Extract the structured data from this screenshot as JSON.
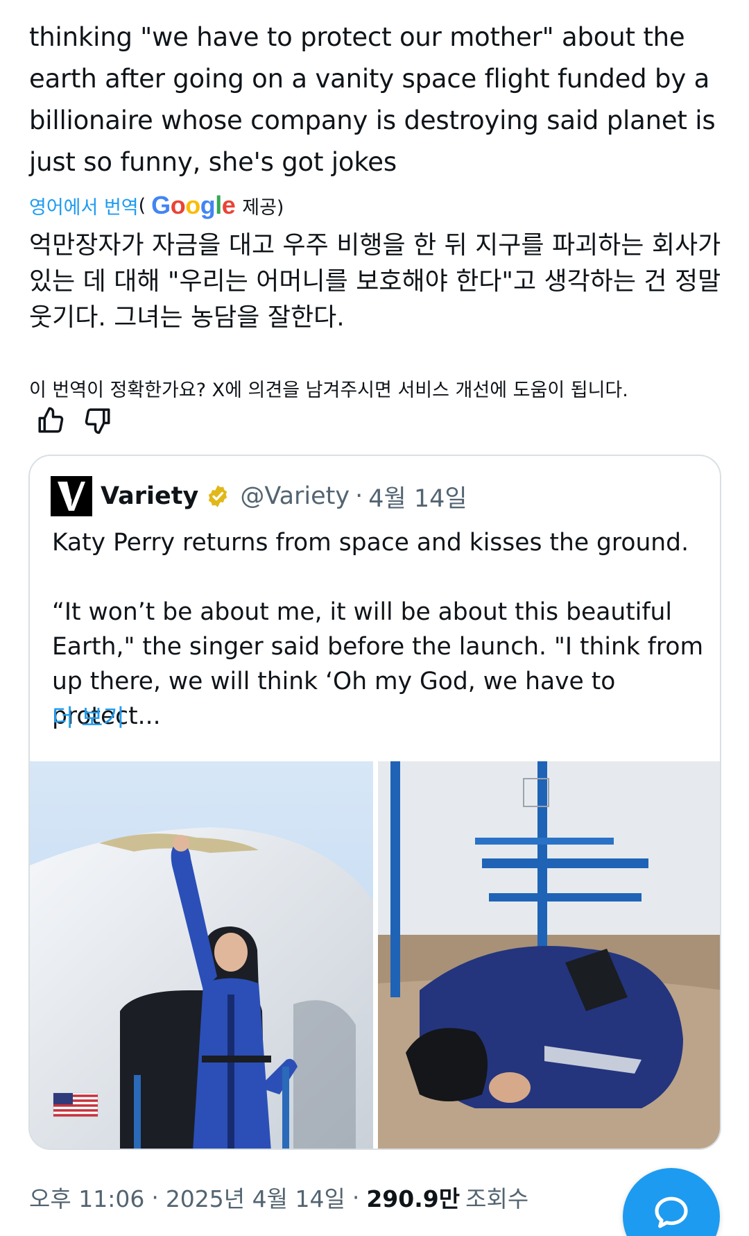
{
  "post": {
    "text": "thinking \"we have to protect our mother\" about the earth after going on a vanity space flight funded by a billionaire whose company is destroying said planet is just so funny, she's got jokes",
    "translate_label": "영어에서 번역",
    "paren_open": "(",
    "google_letters": [
      "G",
      "o",
      "o",
      "g",
      "l",
      "e"
    ],
    "provided_label": "제공)",
    "translated_text": "억만장자가 자금을 대고 우주 비행을 한 뒤 지구를 파괴하는 회사가 있는 데 대해 \"우리는 어머니를 보호해야 한다\"고 생각하는 건 정말 웃기다. 그녀는 농담을 잘한다.",
    "feedback_question": "이 번역이 정확한가요? X에 의견을 남겨주시면 서비스 개선에 도움이 됩니다.",
    "thumbs_up_icon": "thumbs-up-icon",
    "thumbs_down_icon": "thumbs-down-icon"
  },
  "quoted": {
    "name": "Variety",
    "handle": "@Variety",
    "dot": "·",
    "date": "4월 14일",
    "paragraph1": "Katy Perry returns from space and kisses the ground.",
    "paragraph2": "“It won’t be about me, it will be about this beautiful Earth,\" the singer said before the launch. \"I think from up there, we will think ‘Oh my God, we have to protect...",
    "show_more": "더 보기",
    "verified_color": "#e2b719",
    "avatar_icon": "variety-v-logo"
  },
  "footer": {
    "time": "오후 11:06",
    "sep1": "·",
    "date": "2025년 4월 14일",
    "sep2": "·",
    "views": "290.9만",
    "views_label": "조회수"
  },
  "fab_icon": "compose-reply-icon",
  "colors": {
    "accent": "#1d9bf0",
    "text": "#0f1419",
    "muted": "#536471"
  }
}
